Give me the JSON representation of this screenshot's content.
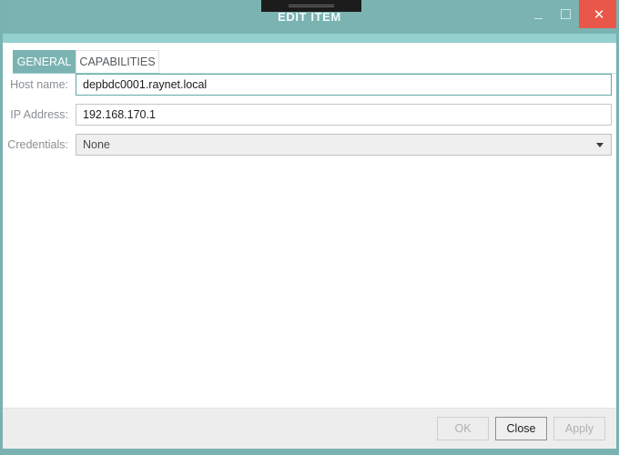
{
  "window": {
    "title": "EDIT ITEM",
    "accent_color": "#7ab3b2",
    "close_color": "#e8574a",
    "controls": {
      "minimize_label": "",
      "maximize_label": "",
      "close_label": "✕"
    }
  },
  "tabs": [
    {
      "label": "GENERAL",
      "active": true
    },
    {
      "label": "CAPABILITIES",
      "active": false
    }
  ],
  "form": {
    "fields": [
      {
        "label": "Host name:",
        "value": "depbdc0001.raynet.local",
        "placeholder": "",
        "type": "text",
        "focused": true
      },
      {
        "label": "IP Address:",
        "value": "192.168.170.1",
        "placeholder": "",
        "type": "text",
        "focused": false
      },
      {
        "label": "Credentials:",
        "value": "None",
        "type": "select",
        "options": [
          "None"
        ]
      }
    ]
  },
  "footer": {
    "buttons": [
      {
        "label": "OK",
        "enabled": false
      },
      {
        "label": "Close",
        "enabled": true
      },
      {
        "label": "Apply",
        "enabled": false
      }
    ]
  }
}
